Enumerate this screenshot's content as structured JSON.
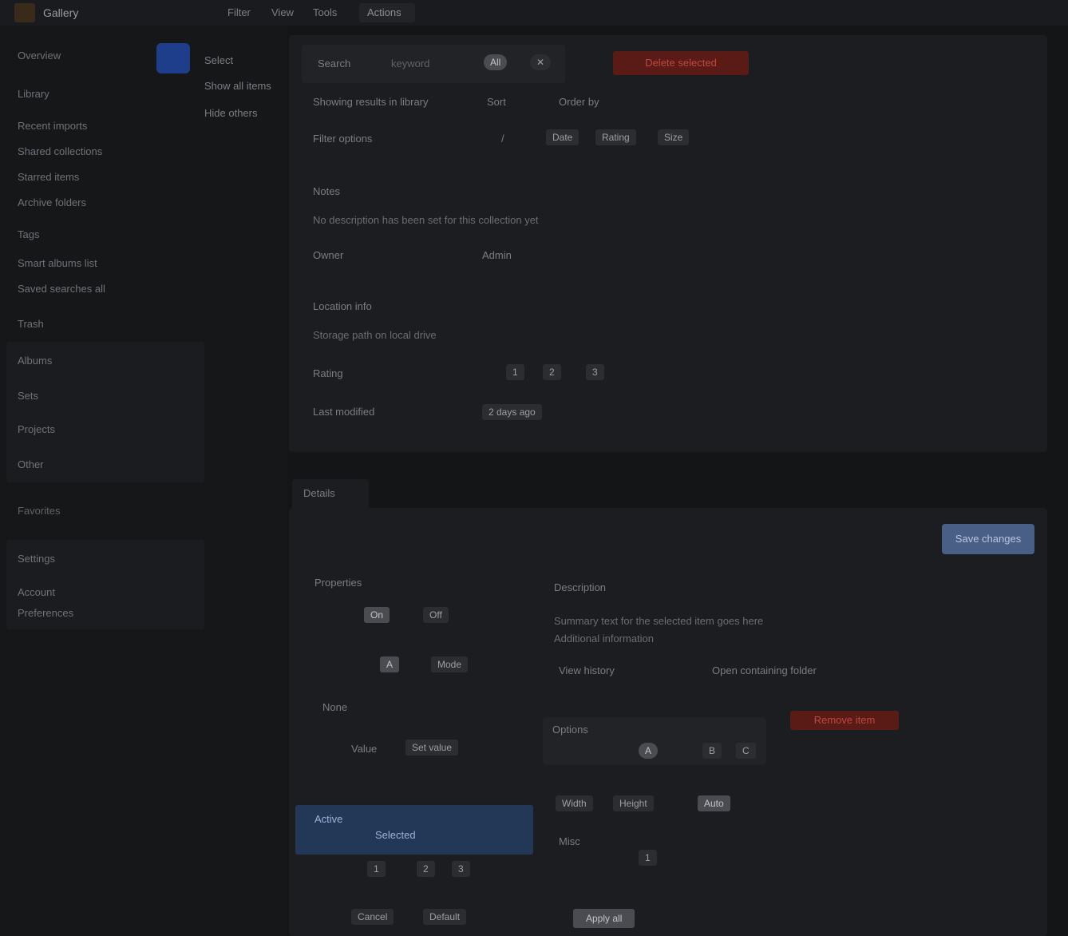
{
  "app": {
    "title": "Gallery"
  },
  "topnav": [
    "Filter",
    "View",
    "Tools"
  ],
  "topbar_button": "Actions",
  "sidebar": {
    "items": [
      "Overview",
      "Library",
      "Recent imports",
      "Shared collections",
      "Starred items",
      "Archive folders",
      "Tags",
      "Smart albums list",
      "Saved searches all",
      "Trash"
    ],
    "group": [
      "Albums",
      "Sets",
      "Projects",
      "Other"
    ],
    "section_label": "Favorites",
    "section2": [
      "Settings",
      "Account",
      "Preferences"
    ],
    "sub_menu": [
      "Select",
      "Show all items",
      "Hide others"
    ]
  },
  "top_card": {
    "search_label": "Search",
    "search_value": "keyword",
    "toggle_a": "All",
    "toggle_b": "✕",
    "delete_label": "Delete selected",
    "subtitle": "Showing results in library",
    "sort_a": "Sort",
    "sort_b": "Order by",
    "filter_label": "Filter options",
    "filter_chip_1": "Date",
    "filter_chip_2": "Rating",
    "filter_chip_3": "Size",
    "filter_sep": "/",
    "notes_label": "Notes",
    "notes_value": "No description has been set for this collection yet",
    "owner_label": "Owner",
    "owner_value": "Admin",
    "location_label": "Location info",
    "location_value": "Storage path on local drive",
    "rating_label": "Rating",
    "rating_a": "1",
    "rating_b": "2",
    "rating_c": "3",
    "modified_label": "Last modified",
    "modified_value": "2 days ago"
  },
  "section_tab": "Details",
  "bottom_card": {
    "save_label": "Save changes",
    "left_title": "Properties",
    "rows": [
      {
        "a": "On",
        "b": "Off"
      },
      {
        "a": "A",
        "b": "Mode"
      },
      {
        "a": "None",
        "b": ""
      },
      {
        "a": "Value",
        "b": "Set value"
      }
    ],
    "hl_a": "Active",
    "hl_b": "Selected",
    "bottom_row_1": [
      "1",
      "2",
      "3"
    ],
    "bottom_row_2": [
      "Cancel",
      "Default"
    ],
    "right_title": "Description",
    "right_text": "Summary text for the selected item goes here",
    "right_text2": "Additional information",
    "right_links": [
      "View history",
      "Open containing folder"
    ],
    "warn_label": "Remove item",
    "options_label": "Options",
    "options_a": "A",
    "options_b": "B",
    "options_c": "C",
    "props_row": [
      "Width",
      "Height",
      "Auto"
    ],
    "misc_label": "Misc",
    "misc_value": "1",
    "apply_label": "Apply all"
  }
}
